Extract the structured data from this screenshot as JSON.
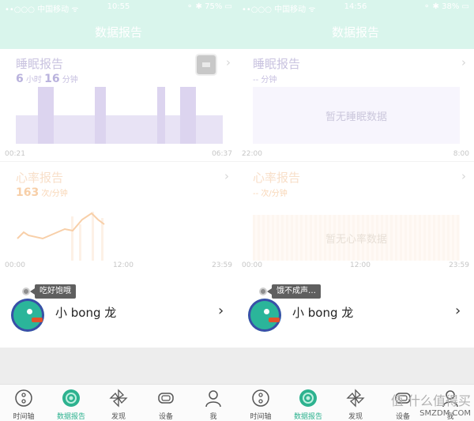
{
  "left": {
    "status": {
      "carrier": "••○○○ 中国移动 ᯤ",
      "time": "10:55",
      "battery": "75%"
    },
    "header_title": "数据报告",
    "sleep": {
      "title": "睡眠报告",
      "hours": "6",
      "hours_unit": "小时",
      "minutes": "16",
      "minutes_unit": "分钟",
      "axis_start": "00:21",
      "axis_end": "06:37"
    },
    "heart": {
      "title": "心率报告",
      "value": "163",
      "unit": "次/分钟",
      "axis_start": "00:00",
      "axis_mid": "12:00",
      "axis_end": "23:59"
    },
    "profile": {
      "bubble": "吃好饱哦",
      "name": "小 bong 龙"
    }
  },
  "right": {
    "status": {
      "carrier": "••○○○ 中国移动 ᯤ",
      "time": "14:56",
      "battery": "38%"
    },
    "header_title": "数据报告",
    "sleep": {
      "title": "睡眠报告",
      "value": "-- 分钟",
      "empty": "暂无睡眠数据",
      "axis_start": "22:00",
      "axis_end": "8:00"
    },
    "heart": {
      "title": "心率报告",
      "value": "-- 次/分钟",
      "empty": "暂无心率数据",
      "axis_start": "00:00",
      "axis_mid": "12:00",
      "axis_end": "23:59"
    },
    "profile": {
      "bubble": "饿不成声…",
      "name": "小 bong 龙"
    }
  },
  "tabs": [
    "时间轴",
    "数据报告",
    "发现",
    "设备",
    "我"
  ],
  "active_tab": "数据报告",
  "watermark": {
    "top": "值 什么值得买",
    "bottom": "SMZDM.COM"
  },
  "colors": {
    "accent": "#2db28f",
    "header": "#d9f5ec",
    "sleep": "#e6e1f4",
    "heart": "#f7c79f"
  },
  "icons": {
    "timeline": "timeline-icon",
    "report": "report-icon",
    "discover": "pinwheel-icon",
    "device": "band-icon",
    "me": "person-icon",
    "chevron": "chevron-right-icon"
  }
}
